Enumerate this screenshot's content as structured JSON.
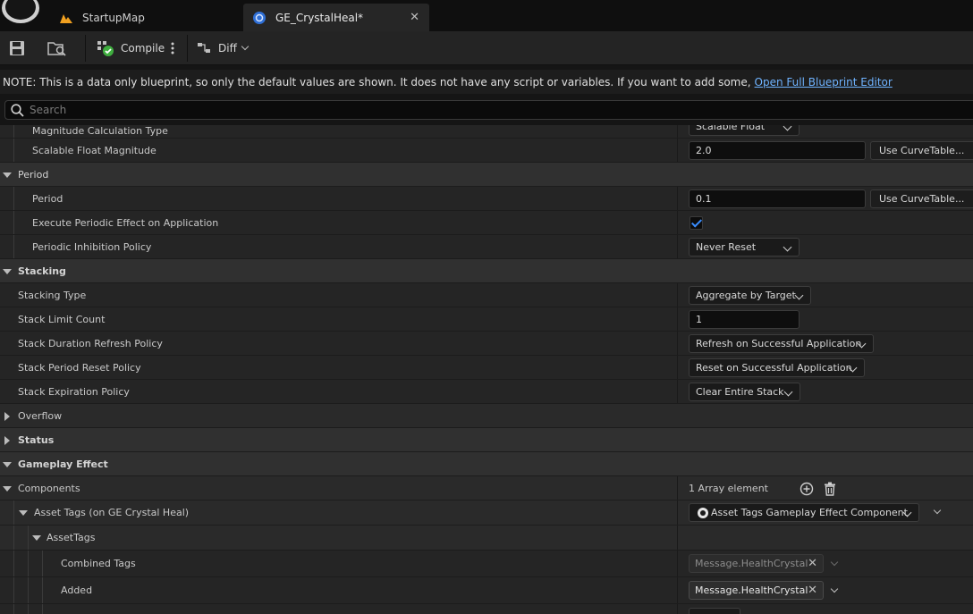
{
  "tabs": [
    {
      "label": "StartupMap"
    },
    {
      "label": "GE_CrystalHeal*"
    }
  ],
  "toolbar": {
    "compile_label": "Compile",
    "diff_label": "Diff"
  },
  "note": {
    "text": "NOTE: This is a data only blueprint, so only the default values are shown.  It does not have any script or variables.  If you want to add some,",
    "link": "Open Full Blueprint Editor"
  },
  "search": {
    "placeholder": "Search"
  },
  "rows": {
    "magnitude_calc": {
      "label": "Magnitude Calculation Type",
      "value": "Scalable Float"
    },
    "scalable_float": {
      "label": "Scalable Float Magnitude",
      "value": "2.0",
      "button": "Use CurveTable..."
    },
    "period_cat": {
      "label": "Period"
    },
    "period": {
      "label": "Period",
      "value": "0.1",
      "button": "Use CurveTable..."
    },
    "exec_periodic": {
      "label": "Execute Periodic Effect on Application",
      "checked": true
    },
    "periodic_inhibition": {
      "label": "Periodic Inhibition Policy",
      "value": "Never Reset"
    },
    "stacking_cat": {
      "label": "Stacking"
    },
    "stacking_type": {
      "label": "Stacking Type",
      "value": "Aggregate by Target"
    },
    "stack_limit": {
      "label": "Stack Limit Count",
      "value": "1"
    },
    "stack_duration": {
      "label": "Stack Duration Refresh Policy",
      "value": "Refresh on Successful Application"
    },
    "stack_period": {
      "label": "Stack Period Reset Policy",
      "value": "Reset on Successful Application"
    },
    "stack_expiration": {
      "label": "Stack Expiration Policy",
      "value": "Clear Entire Stack"
    },
    "overflow_cat": {
      "label": "Overflow"
    },
    "status_cat": {
      "label": "Status"
    },
    "gameplay_effect_cat": {
      "label": "Gameplay Effect"
    },
    "components": {
      "label": "Components",
      "value": "1 Array element"
    },
    "asset_tags_comp": {
      "label": "Asset Tags (on GE Crystal Heal)",
      "value": "Asset Tags Gameplay Effect Component"
    },
    "asset_tags": {
      "label": "AssetTags"
    },
    "combined_tags": {
      "label": "Combined Tags",
      "value": "Message.HealthCrystal"
    },
    "added": {
      "label": "Added",
      "value": "Message.HealthCrystal"
    }
  },
  "colors": {
    "accent": "#3a8dff",
    "link": "#6fb3ff",
    "ue_orange": "#f0a020"
  }
}
